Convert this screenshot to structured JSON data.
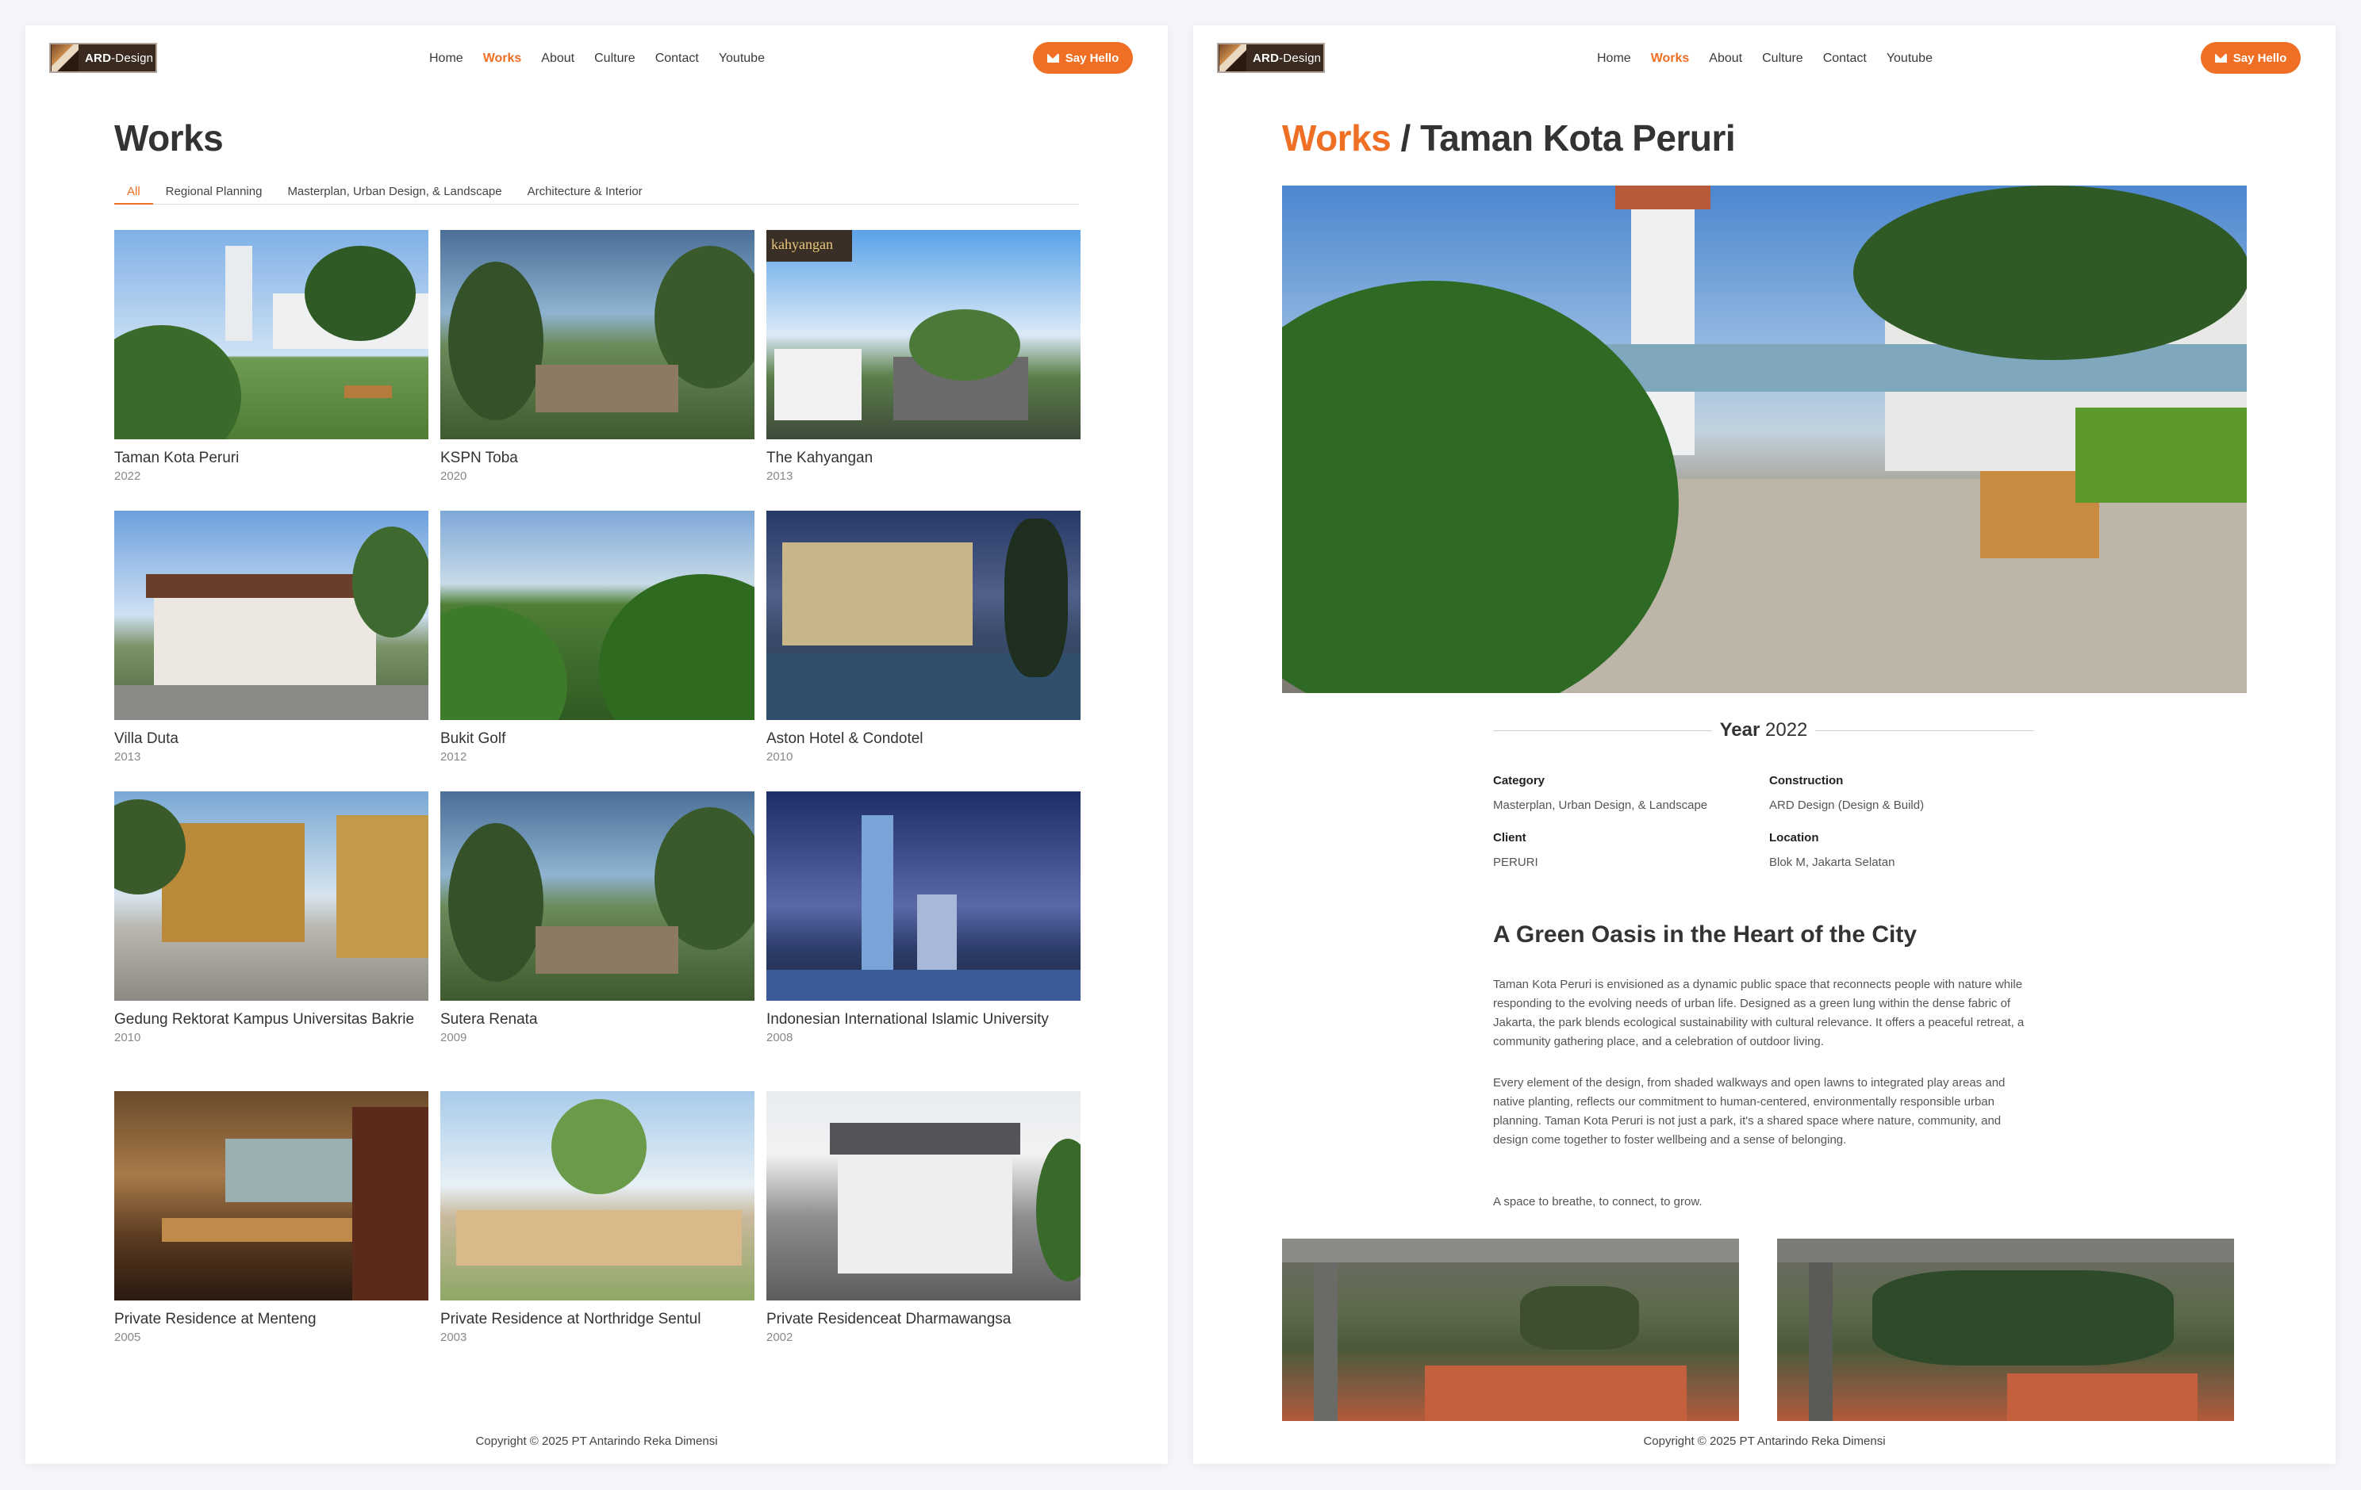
{
  "brand": {
    "logo_text_bold": "ARD",
    "logo_text_rest": "-Design"
  },
  "nav": [
    "Home",
    "Works",
    "About",
    "Culture",
    "Contact",
    "Youtube"
  ],
  "nav_active": "Works",
  "cta": {
    "label": "Say Hello",
    "icon": "envelope-icon"
  },
  "colors": {
    "accent": "#ef6f24",
    "text": "#333333",
    "muted": "#888888"
  },
  "works_page": {
    "title": "Works",
    "tabs": [
      "All",
      "Regional Planning",
      "Masterplan, Urban Design, & Landscape",
      "Architecture & Interior"
    ],
    "active_tab": "All",
    "projects": [
      {
        "title": "Taman Kota Peruri",
        "year": "2022"
      },
      {
        "title": "KSPN Toba",
        "year": "2020"
      },
      {
        "title": "The Kahyangan",
        "year": "2013"
      },
      {
        "title": "Villa Duta",
        "year": "2013"
      },
      {
        "title": "Bukit Golf",
        "year": "2012"
      },
      {
        "title": "Aston Hotel & Condotel",
        "year": "2010"
      },
      {
        "title": "Gedung Rektorat Kampus Universitas Bakrie",
        "year": "2010"
      },
      {
        "title": "Sutera Renata",
        "year": "2009"
      },
      {
        "title": "Indonesian International Islamic University",
        "year": "2008"
      },
      {
        "title": "Private Residence at Menteng",
        "year": "2005"
      },
      {
        "title": "Private Residence at Northridge Sentul",
        "year": "2003"
      },
      {
        "title": "Private Residenceat Dharmawangsa",
        "year": "2002"
      }
    ],
    "kahyangan_badge": "kahyangan"
  },
  "detail_page": {
    "breadcrumb_parent": "Works",
    "breadcrumb_sep": " / ",
    "title": "Taman Kota Peruri",
    "year_label": "Year",
    "year_value": "2022",
    "meta": {
      "category_label": "Category",
      "category_value": "Masterplan, Urban Design, & Landscape",
      "construction_label": "Construction",
      "construction_value": "ARD Design (Design & Build)",
      "client_label": "Client",
      "client_value": "PERURI",
      "location_label": "Location",
      "location_value": "Blok M, Jakarta Selatan"
    },
    "subheading": "A Green Oasis in the Heart of the City",
    "paragraphs": [
      "Taman Kota Peruri is envisioned as a dynamic public space that reconnects people with nature while responding to the evolving needs of urban life. Designed as a green lung within the dense fabric of Jakarta, the park blends ecological sustainability with cultural relevance. It offers a peaceful retreat, a community gathering place, and a celebration of outdoor living.",
      "Every element of the design, from shaded walkways and open lawns to integrated play areas and native planting, reflects our commitment to human-centered, environmentally responsible urban planning. Taman Kota Peruri is not just a park, it's a shared space where nature, community, and design come together to foster wellbeing and a sense of belonging.",
      "A space to breathe, to connect, to grow."
    ]
  },
  "footer": "Copyright © 2025 PT Antarindo Reka Dimensi"
}
